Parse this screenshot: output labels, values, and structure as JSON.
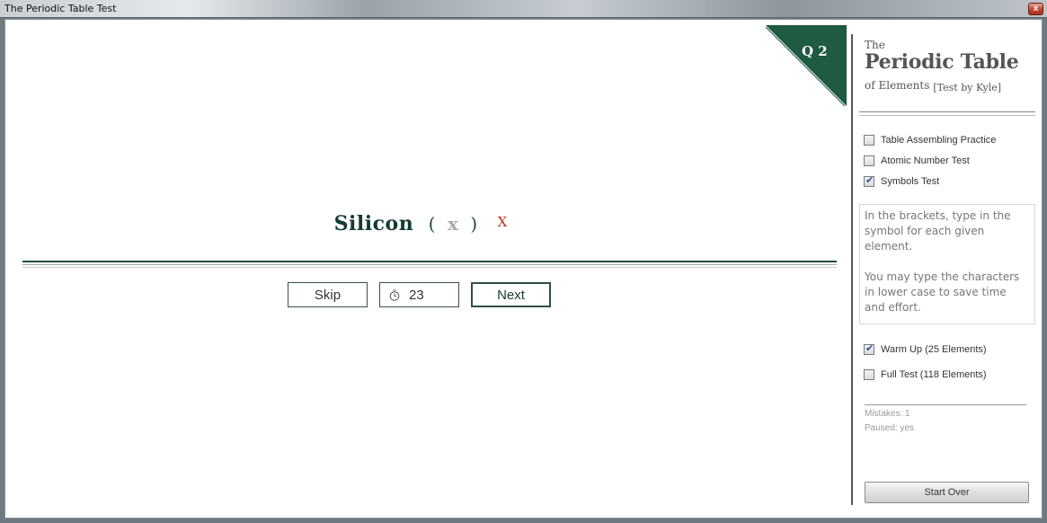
{
  "window": {
    "title": "The Periodic Table Test",
    "close_label": "x"
  },
  "question": {
    "number_label": "Q 2",
    "element_name": "Silicon",
    "open_bracket": "(",
    "close_bracket": ")",
    "answer_value": "x",
    "result_mark": "X"
  },
  "controls": {
    "skip_label": "Skip",
    "timer_value": "23",
    "next_label": "Next"
  },
  "brand": {
    "line1": "The",
    "line2": "Periodic Table",
    "line3": "of Elements",
    "byline": "[Test by Kyle]"
  },
  "modes": [
    {
      "label": "Table Assembling Practice",
      "checked": false
    },
    {
      "label": "Atomic Number Test",
      "checked": false
    },
    {
      "label": "Symbols Test",
      "checked": true
    }
  ],
  "instructions": {
    "p1": "In the brackets, type in the symbol for each given element.",
    "p2": "You may type the characters in lower case to save time and effort."
  },
  "test_length": [
    {
      "label": "Warm Up (25 Elements)",
      "checked": true
    },
    {
      "label": "Full Test (118 Elements)",
      "checked": false
    }
  ],
  "stats": {
    "mistakes": "Mistakes: 1",
    "paused": "Paused: yes"
  },
  "start_over_label": "Start Over",
  "colors": {
    "accent": "#1f5a42",
    "heading": "#123b35",
    "mistake": "#b8321f"
  }
}
